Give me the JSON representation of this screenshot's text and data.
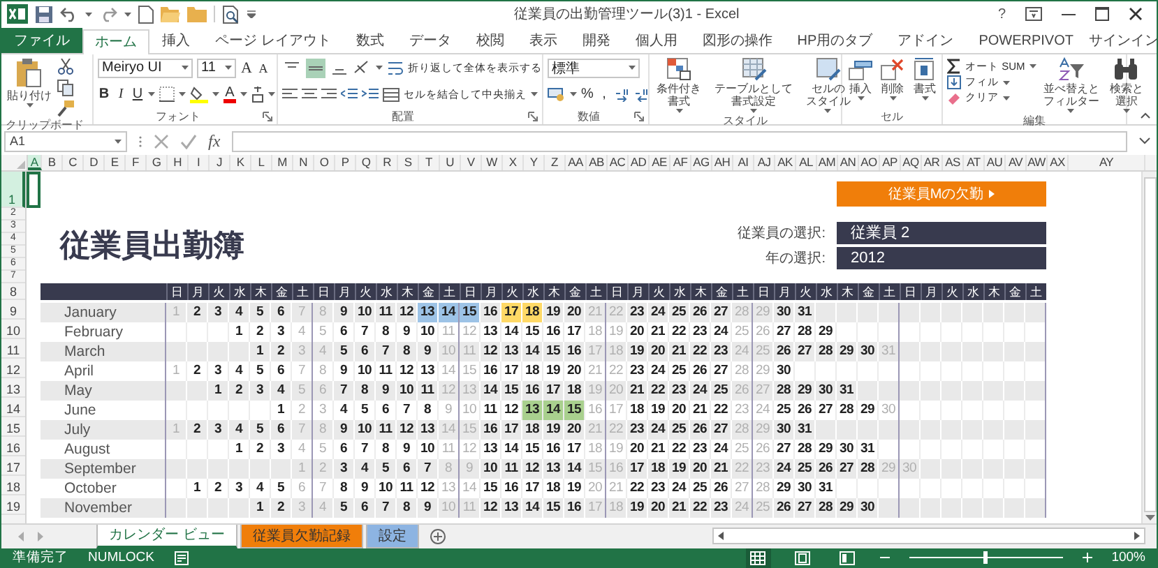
{
  "window": {
    "title": "従業員の出勤管理ツール(3)1 - Excel",
    "help": "?"
  },
  "ribbon_tabs": [
    {
      "label": "ファイル",
      "kind": "file",
      "selected": false
    },
    {
      "label": "ホーム",
      "kind": "tab",
      "selected": true
    },
    {
      "label": "挿入",
      "kind": "tab",
      "selected": false
    },
    {
      "label": "ページ レイアウト",
      "kind": "tab",
      "selected": false
    },
    {
      "label": "数式",
      "kind": "tab",
      "selected": false
    },
    {
      "label": "データ",
      "kind": "tab",
      "selected": false
    },
    {
      "label": "校閲",
      "kind": "tab",
      "selected": false
    },
    {
      "label": "表示",
      "kind": "tab",
      "selected": false
    },
    {
      "label": "開発",
      "kind": "tab",
      "selected": false
    },
    {
      "label": "個人用",
      "kind": "tab",
      "selected": false
    },
    {
      "label": "図形の操作",
      "kind": "tab",
      "selected": false
    },
    {
      "label": "HP用のタブ",
      "kind": "tab",
      "selected": false
    },
    {
      "label": "アドイン",
      "kind": "tab",
      "selected": false
    },
    {
      "label": "POWERPIVOT",
      "kind": "tab",
      "selected": false
    }
  ],
  "account": {
    "label": "サインイン"
  },
  "ribbon": {
    "clipboard": {
      "paste": "貼り付け",
      "group": "クリップボード"
    },
    "font": {
      "font_name": "Meiryo UI",
      "font_size": "11",
      "grow": "A",
      "shrink": "A",
      "bold": "B",
      "italic": "I",
      "underline": "U",
      "font_color": "A",
      "group": "フォント"
    },
    "alignment": {
      "vertical": [
        {
          "kind": "top",
          "selected": false
        },
        {
          "kind": "middle",
          "selected": true
        },
        {
          "kind": "bottom",
          "selected": false
        }
      ],
      "wrap": "折り返して全体を表示する",
      "merge": "セルを結合して中央揃え",
      "group": "配置"
    },
    "number": {
      "format": "標準",
      "percent": "%",
      "comma": ",",
      "group": "数値"
    },
    "styles": {
      "buttons": [
        "条件付き書式",
        "テーブルとして書式設定",
        "セルのスタイル"
      ],
      "group": "スタイル"
    },
    "cells": {
      "buttons": [
        "挿入",
        "削除",
        "書式"
      ],
      "group": "セル"
    },
    "editing": {
      "autosum": "オート SUM",
      "fill": "フィル",
      "clear": "クリア",
      "sort": "並べ替えとフィルター",
      "find": "検索と選択",
      "group": "編集"
    }
  },
  "formula_bar": {
    "name_box": "A1",
    "fx": "fx"
  },
  "columns": [
    {
      "label": "A",
      "selected": true
    },
    {
      "label": "B",
      "selected": false
    },
    {
      "label": "C",
      "selected": false
    },
    {
      "label": "D",
      "selected": false
    },
    {
      "label": "E",
      "selected": false
    },
    {
      "label": "F",
      "selected": false
    },
    {
      "label": "G",
      "selected": false
    },
    {
      "label": "H",
      "selected": false
    },
    {
      "label": "I",
      "selected": false
    },
    {
      "label": "J",
      "selected": false
    },
    {
      "label": "K",
      "selected": false
    },
    {
      "label": "L",
      "selected": false
    },
    {
      "label": "M",
      "selected": false
    },
    {
      "label": "N",
      "selected": false
    },
    {
      "label": "O",
      "selected": false
    },
    {
      "label": "P",
      "selected": false
    },
    {
      "label": "Q",
      "selected": false
    },
    {
      "label": "R",
      "selected": false
    },
    {
      "label": "S",
      "selected": false
    },
    {
      "label": "T",
      "selected": false
    },
    {
      "label": "U",
      "selected": false
    },
    {
      "label": "V",
      "selected": false
    },
    {
      "label": "W",
      "selected": false
    },
    {
      "label": "X",
      "selected": false
    },
    {
      "label": "Y",
      "selected": false
    },
    {
      "label": "Z",
      "selected": false
    },
    {
      "label": "AA",
      "selected": false
    },
    {
      "label": "AB",
      "selected": false
    },
    {
      "label": "AC",
      "selected": false
    },
    {
      "label": "AD",
      "selected": false
    },
    {
      "label": "AE",
      "selected": false
    },
    {
      "label": "AF",
      "selected": false
    },
    {
      "label": "AG",
      "selected": false
    },
    {
      "label": "AH",
      "selected": false
    },
    {
      "label": "AI",
      "selected": false
    },
    {
      "label": "AJ",
      "selected": false
    },
    {
      "label": "AK",
      "selected": false
    },
    {
      "label": "AL",
      "selected": false
    },
    {
      "label": "AM",
      "selected": false
    },
    {
      "label": "AN",
      "selected": false
    },
    {
      "label": "AO",
      "selected": false
    },
    {
      "label": "AP",
      "selected": false
    },
    {
      "label": "AQ",
      "selected": false
    },
    {
      "label": "AR",
      "selected": false
    },
    {
      "label": "AS",
      "selected": false
    },
    {
      "label": "AT",
      "selected": false
    },
    {
      "label": "AU",
      "selected": false
    },
    {
      "label": "AV",
      "selected": false
    },
    {
      "label": "AW",
      "selected": false
    },
    {
      "label": "AX",
      "selected": false
    },
    {
      "label": "AY",
      "selected": false
    }
  ],
  "rows": [
    {
      "label": "1",
      "selected": true
    },
    {
      "label": "2",
      "selected": false
    },
    {
      "label": "3",
      "selected": false
    },
    {
      "label": "4",
      "selected": false
    },
    {
      "label": "5",
      "selected": false
    },
    {
      "label": "6",
      "selected": false
    },
    {
      "label": "7",
      "selected": false
    },
    {
      "label": "8",
      "selected": false
    },
    {
      "label": "9",
      "selected": false
    },
    {
      "label": "10",
      "selected": false
    },
    {
      "label": "11",
      "selected": false
    },
    {
      "label": "12",
      "selected": false
    },
    {
      "label": "13",
      "selected": false
    },
    {
      "label": "14",
      "selected": false
    },
    {
      "label": "15",
      "selected": false
    },
    {
      "label": "16",
      "selected": false
    },
    {
      "label": "17",
      "selected": false
    },
    {
      "label": "18",
      "selected": false
    },
    {
      "label": "19",
      "selected": false
    }
  ],
  "absence_button": {
    "label": "従業員Mの欠勤"
  },
  "title": "従業員出勤簿",
  "selectors": [
    {
      "label": "従業員の選択:",
      "value": "従業員 2"
    },
    {
      "label": "年の選択:",
      "value": "2012"
    }
  ],
  "calendar": {
    "weekdays": [
      "日",
      "月",
      "火",
      "水",
      "木",
      "金",
      "土",
      "日",
      "月",
      "火",
      "水",
      "木",
      "金",
      "土",
      "日",
      "月",
      "火",
      "水",
      "木",
      "金",
      "土",
      "日",
      "月",
      "火",
      "水",
      "木",
      "金",
      "土",
      "日",
      "月",
      "火",
      "水",
      "木",
      "金",
      "土",
      "日",
      "月",
      "火",
      "水",
      "木",
      "金",
      "土"
    ],
    "months": [
      {
        "name": "January",
        "days": [
          "1",
          "2",
          "3",
          "4",
          "5",
          "6",
          "7",
          "8",
          "9",
          "10",
          "11",
          "12",
          {
            "text": "13",
            "color": "#9dc3e6"
          },
          {
            "text": "14",
            "color": "#9dc3e6"
          },
          {
            "text": "15",
            "color": "#9dc3e6"
          },
          "16",
          {
            "text": "17",
            "color": "#ffd966"
          },
          {
            "text": "18",
            "color": "#ffd966"
          },
          "19",
          "20",
          "21",
          "22",
          "23",
          "24",
          "25",
          "26",
          "27",
          "28",
          "29",
          "30",
          "31"
        ]
      },
      {
        "name": "February",
        "days": [
          {
            "kind": "blank"
          },
          {
            "kind": "blank"
          },
          {
            "kind": "blank"
          },
          "1",
          "2",
          "3",
          "4",
          "5",
          "6",
          "7",
          "8",
          "9",
          "10",
          "11",
          "12",
          "13",
          "14",
          "15",
          "16",
          "17",
          "18",
          "19",
          "20",
          "21",
          "22",
          "23",
          "24",
          "25",
          "26",
          "27",
          "28",
          "29"
        ]
      },
      {
        "name": "March",
        "days": [
          {
            "kind": "blank"
          },
          {
            "kind": "blank"
          },
          {
            "kind": "blank"
          },
          {
            "kind": "blank"
          },
          "1",
          "2",
          "3",
          "4",
          "5",
          "6",
          "7",
          "8",
          "9",
          "10",
          "11",
          "12",
          "13",
          "14",
          "15",
          "16",
          "17",
          "18",
          "19",
          "20",
          "21",
          "22",
          "23",
          "24",
          "25",
          "26",
          "27",
          "28",
          "29",
          "30",
          "31"
        ]
      },
      {
        "name": "April",
        "days": [
          "1",
          "2",
          "3",
          "4",
          "5",
          "6",
          "7",
          "8",
          "9",
          "10",
          "11",
          "12",
          "13",
          "14",
          "15",
          "16",
          "17",
          "18",
          "19",
          "20",
          "21",
          "22",
          "23",
          "24",
          "25",
          "26",
          "27",
          "28",
          "29",
          "30"
        ]
      },
      {
        "name": "May",
        "days": [
          {
            "kind": "blank"
          },
          {
            "kind": "blank"
          },
          "1",
          "2",
          "3",
          "4",
          "5",
          "6",
          "7",
          "8",
          "9",
          "10",
          "11",
          "12",
          "13",
          "14",
          "15",
          "16",
          "17",
          "18",
          "19",
          "20",
          "21",
          "22",
          "23",
          "24",
          "25",
          "26",
          "27",
          "28",
          "29",
          "30",
          "31"
        ]
      },
      {
        "name": "June",
        "days": [
          {
            "kind": "blank"
          },
          {
            "kind": "blank"
          },
          {
            "kind": "blank"
          },
          {
            "kind": "blank"
          },
          {
            "kind": "blank"
          },
          "1",
          "2",
          "3",
          "4",
          "5",
          "6",
          "7",
          "8",
          "9",
          "10",
          "11",
          "12",
          {
            "text": "13",
            "color": "#a9d08e"
          },
          {
            "text": "14",
            "color": "#a9d08e"
          },
          {
            "text": "15",
            "color": "#a9d08e"
          },
          "16",
          "17",
          "18",
          "19",
          "20",
          "21",
          "22",
          "23",
          "24",
          "25",
          "26",
          "27",
          "28",
          "29",
          "30"
        ]
      },
      {
        "name": "July",
        "days": [
          "1",
          "2",
          "3",
          "4",
          "5",
          "6",
          "7",
          "8",
          "9",
          "10",
          "11",
          "12",
          "13",
          "14",
          "15",
          "16",
          "17",
          "18",
          "19",
          "20",
          "21",
          "22",
          "23",
          "24",
          "25",
          "26",
          "27",
          "28",
          "29",
          "30",
          "31"
        ]
      },
      {
        "name": "August",
        "days": [
          {
            "kind": "blank"
          },
          {
            "kind": "blank"
          },
          {
            "kind": "blank"
          },
          "1",
          "2",
          "3",
          "4",
          "5",
          "6",
          "7",
          "8",
          "9",
          "10",
          "11",
          "12",
          "13",
          "14",
          "15",
          "16",
          "17",
          "18",
          "19",
          "20",
          "21",
          "22",
          "23",
          "24",
          "25",
          "26",
          "27",
          "28",
          "29",
          "30",
          "31"
        ]
      },
      {
        "name": "September",
        "days": [
          {
            "kind": "blank"
          },
          {
            "kind": "blank"
          },
          {
            "kind": "blank"
          },
          {
            "kind": "blank"
          },
          {
            "kind": "blank"
          },
          {
            "kind": "blank"
          },
          "1",
          "2",
          "3",
          "4",
          "5",
          "6",
          "7",
          "8",
          "9",
          "10",
          "11",
          "12",
          "13",
          "14",
          "15",
          "16",
          "17",
          "18",
          "19",
          "20",
          "21",
          "22",
          "23",
          "24",
          "25",
          "26",
          "27",
          "28",
          "29",
          "30"
        ]
      },
      {
        "name": "October",
        "days": [
          {
            "kind": "blank"
          },
          "1",
          "2",
          "3",
          "4",
          "5",
          "6",
          "7",
          "8",
          "9",
          "10",
          "11",
          "12",
          "13",
          "14",
          "15",
          "16",
          "17",
          "18",
          "19",
          "20",
          "21",
          "22",
          "23",
          "24",
          "25",
          "26",
          "27",
          "28",
          "29",
          "30",
          "31"
        ]
      },
      {
        "name": "November",
        "days": [
          {
            "kind": "blank"
          },
          {
            "kind": "blank"
          },
          {
            "kind": "blank"
          },
          {
            "kind": "blank"
          },
          "1",
          "2",
          "3",
          "4",
          "5",
          "6",
          "7",
          "8",
          "9",
          "10",
          "11",
          "12",
          "13",
          "14",
          "15",
          "16",
          "17",
          "18",
          "19",
          "20",
          "21",
          "22",
          "23",
          "24",
          "25",
          "26",
          "27",
          "28",
          "29",
          "30"
        ]
      }
    ]
  },
  "sheet_tabs": [
    {
      "label": "カレンダー ビュー",
      "selected": true
    },
    {
      "label": "従業員欠勤記録",
      "selected": false,
      "color": "#f07e0a"
    },
    {
      "label": "設定",
      "selected": false,
      "color": "#8db4e2"
    }
  ],
  "status_bar": {
    "ready": "準備完了",
    "numlock": "NUMLOCK",
    "views": [
      {
        "kind": "normal",
        "selected": true
      },
      {
        "kind": "page_layout",
        "selected": false
      },
      {
        "kind": "page_break",
        "selected": false
      }
    ],
    "zoom": {
      "level": 0.5,
      "reading": "100%"
    }
  }
}
